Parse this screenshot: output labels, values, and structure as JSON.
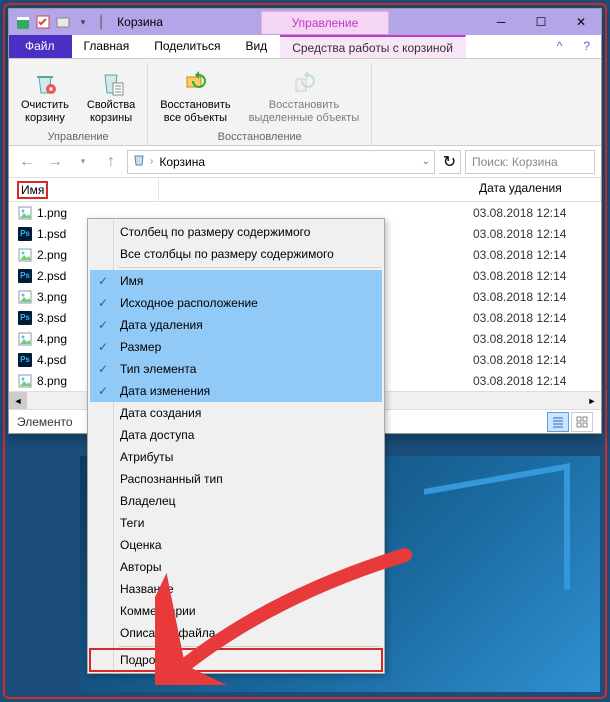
{
  "title": "Корзина",
  "titlebar": {
    "manage": "Управление"
  },
  "tabs": {
    "file": "Файл",
    "home": "Главная",
    "share": "Поделиться",
    "view": "Вид",
    "ctx": "Средства работы с корзиной"
  },
  "ribbon": {
    "empty": "Очистить\nкорзину",
    "props": "Свойства\nкорзины",
    "group1": "Управление",
    "restore_all": "Восстановить\nвсе объекты",
    "restore_sel": "Восстановить\nвыделенные объекты",
    "group2": "Восстановление"
  },
  "address": {
    "root": "Корзина"
  },
  "search": {
    "placeholder": "Поиск: Корзина"
  },
  "columns": {
    "name": "Имя",
    "deleted": "Дата удаления"
  },
  "files": [
    {
      "name": "1.png",
      "type": "png",
      "date": "03.08.2018 12:14"
    },
    {
      "name": "1.psd",
      "type": "psd",
      "date": "03.08.2018 12:14"
    },
    {
      "name": "2.png",
      "type": "png",
      "date": "03.08.2018 12:14"
    },
    {
      "name": "2.psd",
      "type": "psd",
      "date": "03.08.2018 12:14"
    },
    {
      "name": "3.png",
      "type": "png",
      "date": "03.08.2018 12:14"
    },
    {
      "name": "3.psd",
      "type": "psd",
      "date": "03.08.2018 12:14"
    },
    {
      "name": "4.png",
      "type": "png",
      "date": "03.08.2018 12:14"
    },
    {
      "name": "4.psd",
      "type": "psd",
      "date": "03.08.2018 12:14"
    },
    {
      "name": "8.png",
      "type": "png",
      "date": "03.08.2018 12:14"
    }
  ],
  "status": {
    "count_label": "Элементо"
  },
  "menu": {
    "size_col": "Столбец по размеру содержимого",
    "size_all": "Все столбцы по размеру содержимого",
    "items": [
      {
        "label": "Имя",
        "checked": true
      },
      {
        "label": "Исходное расположение",
        "checked": true
      },
      {
        "label": "Дата удаления",
        "checked": true
      },
      {
        "label": "Размер",
        "checked": true
      },
      {
        "label": "Тип элемента",
        "checked": true
      },
      {
        "label": "Дата изменения",
        "checked": true
      },
      {
        "label": "Дата создания",
        "checked": false
      },
      {
        "label": "Дата доступа",
        "checked": false
      },
      {
        "label": "Атрибуты",
        "checked": false
      },
      {
        "label": "Распознанный тип",
        "checked": false
      },
      {
        "label": "Владелец",
        "checked": false
      },
      {
        "label": "Теги",
        "checked": false
      },
      {
        "label": "Оценка",
        "checked": false
      },
      {
        "label": "Авторы",
        "checked": false
      },
      {
        "label": "Название",
        "checked": false
      },
      {
        "label": "Комментарии",
        "checked": false
      },
      {
        "label": "Описание файла",
        "checked": false
      }
    ],
    "more": "Подробнее…"
  }
}
